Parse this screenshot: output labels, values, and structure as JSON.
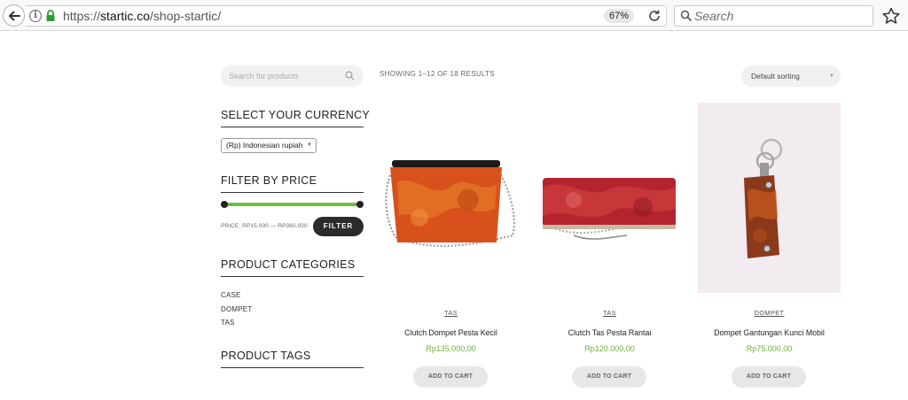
{
  "browser": {
    "url_prefix": "https://",
    "url_host": "startic.co",
    "url_path": "/shop-startic/",
    "zoom": "67%",
    "search_placeholder": "Search"
  },
  "sidebar": {
    "search_placeholder": "Search for products",
    "currency_title": "SELECT YOUR CURRENCY",
    "currency_selected": "(Rp) Indonesian rupiah",
    "filter_title": "FILTER BY PRICE",
    "price_label": "PRICE: RP15,000 — RP360,000",
    "price_range": {
      "min": 15000,
      "max": 360000
    },
    "filter_button": "FILTER",
    "categories_title": "PRODUCT CATEGORIES",
    "categories": [
      "CASE",
      "DOMPET",
      "TAS"
    ],
    "tags_title": "PRODUCT TAGS"
  },
  "main": {
    "result_count": "SHOWING 1–12 OF 18 RESULTS",
    "sorting": "Default sorting",
    "products": [
      {
        "category": "TAS",
        "title": "Clutch Dompet Pesta Kecil",
        "price": "Rp135.000,00",
        "button": "ADD TO CART"
      },
      {
        "category": "TAS",
        "title": "Clutch Tas Pesta Rantai",
        "price": "Rp120.000,00",
        "button": "ADD TO CART"
      },
      {
        "category": "DOMPET",
        "title": "Dompet Gantungan Kunci Mobil",
        "price": "Rp75.000,00",
        "button": "ADD TO CART"
      }
    ]
  },
  "colors": {
    "accent_green": "#6fae3f",
    "slider_green": "#6fbf3f",
    "button_dark": "#2b2b2b"
  }
}
